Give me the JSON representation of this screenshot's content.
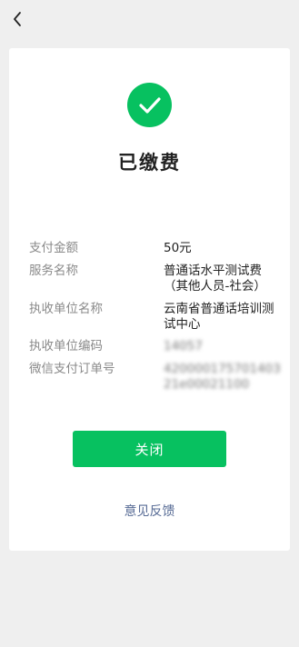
{
  "nav": {
    "back_icon": "chevron-left-icon"
  },
  "status": {
    "icon": "check-circle-icon",
    "title": "已缴费",
    "accent_color": "#07c160"
  },
  "details": [
    {
      "label": "支付金额",
      "value_lines": [
        "50元"
      ]
    },
    {
      "label": "服务名称",
      "value_lines": [
        "普通话水平测试费",
        "（其他人员-社会）"
      ]
    },
    {
      "label": "执收单位名称",
      "value_lines": [
        "云南省普通话培训测",
        "试中心"
      ]
    },
    {
      "label": "执收单位编码",
      "value_lines": [
        "14057"
      ]
    },
    {
      "label": "微信支付订单号",
      "value_lines": [
        "420000175701403",
        "21e00021100"
      ]
    }
  ],
  "actions": {
    "close_label": "关闭",
    "feedback_label": "意见反馈",
    "link_color": "#576b95"
  }
}
